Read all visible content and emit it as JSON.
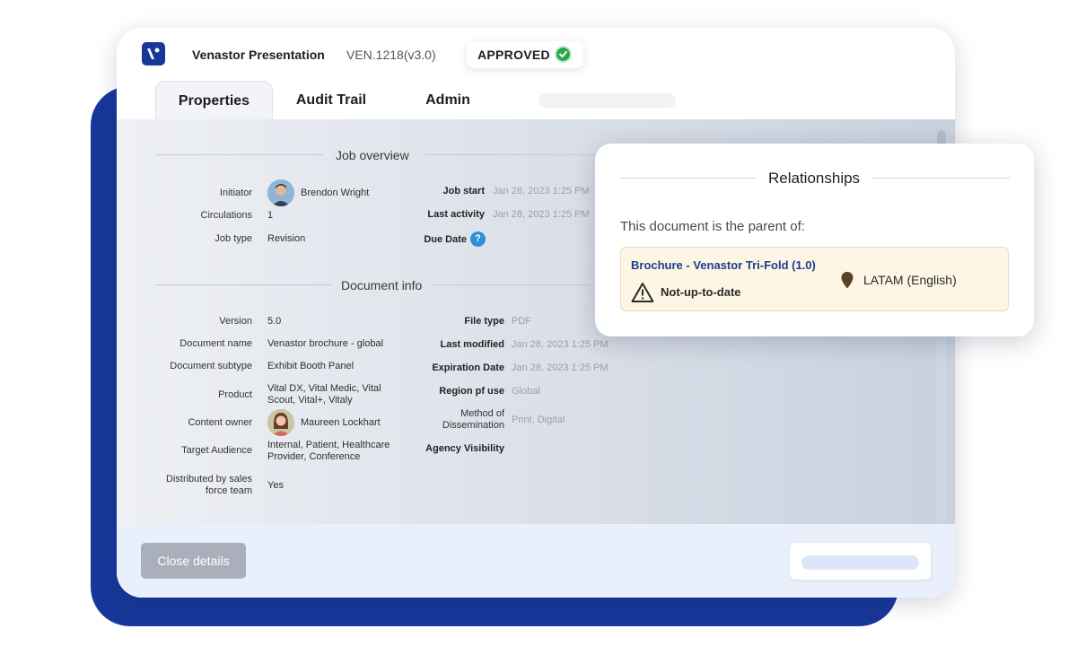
{
  "header": {
    "title": "Venastor Presentation",
    "doc_id": "VEN.1218(v3.0)",
    "status": "APPROVED"
  },
  "tabs": [
    {
      "label": "Properties",
      "active": true
    },
    {
      "label": "Audit Trail",
      "active": false
    },
    {
      "label": "Admin",
      "active": false
    }
  ],
  "job_overview": {
    "title": "Job overview",
    "initiator_label": "Initiator",
    "initiator": "Brendon Wright",
    "circulations_label": "Circulations",
    "circulations": "1",
    "job_type_label": "Job type",
    "job_type": "Revision",
    "job_start_label": "Job start",
    "job_start": "Jan 28, 2023 1:25 PM",
    "last_activity_label": "Last activity",
    "last_activity": "Jan 28, 2023 1:25 PM",
    "due_date_label": "Due Date",
    "due_date_icon": "?"
  },
  "document_info": {
    "title": "Document info",
    "version_label": "Version",
    "version": "5.0",
    "doc_name_label": "Document name",
    "doc_name": "Venastor brochure - global",
    "doc_subtype_label": "Document subtype",
    "doc_subtype": "Exhibit Booth Panel",
    "product_label": "Product",
    "product_line1": "Vital DX, Vital Medic, Vital",
    "product_line2": "Scout, Vital+, Vitaly",
    "content_owner_label": "Content owner",
    "content_owner": "Maureen Lockhart",
    "target_audience_label": "Target Audience",
    "target_audience_line1": "Internal, Patient, Healthcare",
    "target_audience_line2": "Provider, Conference",
    "distributed_label_line1": "Distributed by sales",
    "distributed_label_line2": "force team",
    "distributed": "Yes",
    "file_type_label": "File type",
    "file_type": "PDF",
    "last_modified_label": "Last modified",
    "last_modified": "Jan 28, 2023 1:25 PM",
    "expiration_label": "Expiration Date",
    "expiration": "Jan 28, 2023 1:25 PM",
    "region_label": "Region pf use",
    "region": "Global",
    "method_label_line1": "Method of",
    "method_label_line2": "Dissemination",
    "method": "Print, Digital",
    "agency_label": "Agency Visibility"
  },
  "footer": {
    "close_label": "Close details"
  },
  "relationships": {
    "title": "Relationships",
    "parent_text": "This document is the parent of:",
    "item_link": "Brochure - Venastor Tri-Fold (1.0)",
    "item_status": "Not-up-to-date",
    "item_region": "LATAM (English)"
  },
  "colors": {
    "brand_blue": "#17379a",
    "approved_green": "#2aa84a",
    "link_blue": "#1c3d8f",
    "warning_bg": "#fdf6e4"
  }
}
